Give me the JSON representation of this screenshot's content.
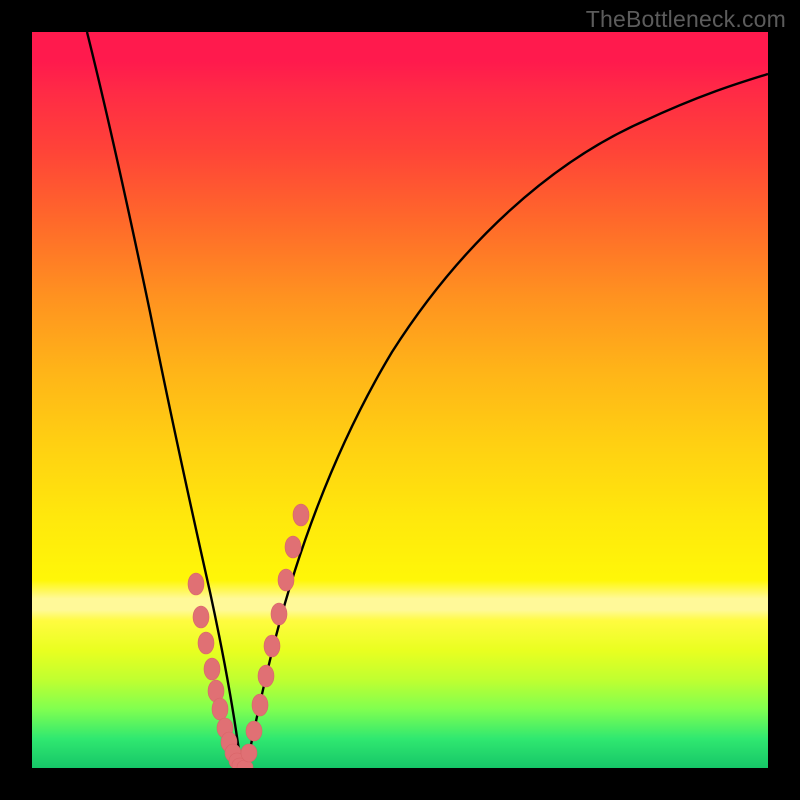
{
  "watermark": {
    "text": "TheBottleneck.com"
  },
  "chart_data": {
    "type": "line",
    "title": "",
    "xlabel": "",
    "ylabel": "",
    "xlim": [
      0,
      100
    ],
    "ylim": [
      0,
      100
    ],
    "grid": false,
    "background": "vertical red-yellow-green gradient (red top, green bottom)",
    "series": [
      {
        "name": "left-branch",
        "color": "#000000",
        "x": [
          7.5,
          9.5,
          11.5,
          13.5,
          15.5,
          17.5,
          19.0,
          20.5,
          22.0,
          23.5,
          25.0,
          26.0,
          27.0,
          27.5,
          28.0
        ],
        "y": [
          100,
          90,
          80,
          70,
          60,
          50,
          42,
          34,
          26,
          18,
          10,
          5,
          2,
          1,
          0
        ]
      },
      {
        "name": "right-branch",
        "color": "#000000",
        "x": [
          29.0,
          29.5,
          30.5,
          32.0,
          34.5,
          38.0,
          43.0,
          49.0,
          56.0,
          64.0,
          72.0,
          80.0,
          88.0,
          94.0,
          100.0
        ],
        "y": [
          0,
          1,
          4,
          10,
          20,
          32,
          46,
          58,
          68,
          76,
          82,
          86.5,
          90,
          92.5,
          94.5
        ]
      },
      {
        "name": "flat-minimum",
        "color": "#000000",
        "x": [
          28.0,
          29.0
        ],
        "y": [
          0,
          0
        ]
      }
    ],
    "scatter": [
      {
        "name": "left-branch-dots",
        "color": "#e07070",
        "x": [
          22.3,
          23.0,
          23.7,
          24.5,
          25.0,
          25.5,
          26.2,
          26.8,
          27.3,
          27.8,
          28.3,
          28.9
        ],
        "y": [
          25.0,
          20.5,
          17.0,
          13.5,
          10.5,
          8.0,
          5.5,
          3.5,
          2.0,
          1.0,
          0.4,
          0.1
        ]
      },
      {
        "name": "right-branch-dots",
        "color": "#e07070",
        "x": [
          29.5,
          30.2,
          31.0,
          31.8,
          32.6,
          33.5,
          34.5,
          35.5,
          36.5
        ],
        "y": [
          2.0,
          5.0,
          8.5,
          12.5,
          16.5,
          21.0,
          25.5,
          30.0,
          34.5
        ]
      }
    ]
  }
}
